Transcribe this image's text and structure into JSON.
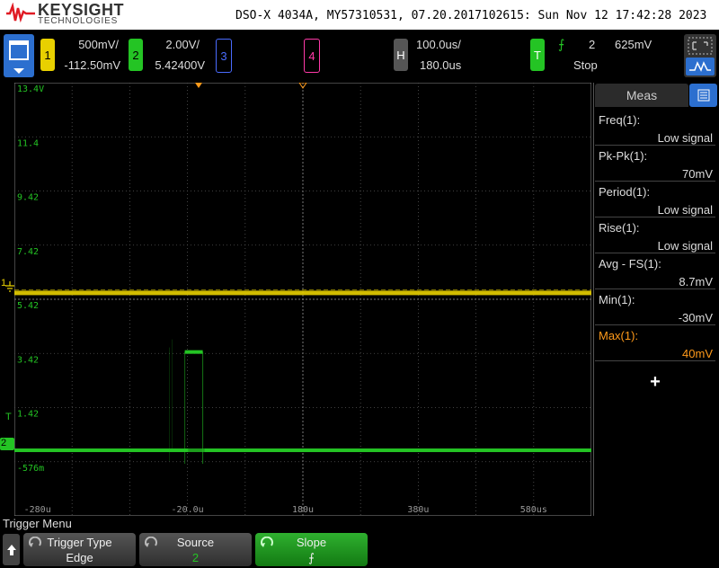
{
  "header": {
    "brand": "KEYSIGHT",
    "brand_sub": "TECHNOLOGIES",
    "scope_id": "DSO-X 4034A, MY57310531, 07.20.2017102615: Sun Nov 12 17:42:28 2023"
  },
  "channels": [
    {
      "num": "1",
      "scale": "500mV/",
      "offset": "-112.50mV",
      "color": "#e8d000"
    },
    {
      "num": "2",
      "scale": "2.00V/",
      "offset": "5.42400V",
      "color": "#24c424"
    },
    {
      "num": "3",
      "color": "#4a6cff"
    },
    {
      "num": "4",
      "color": "#ff3aa8"
    }
  ],
  "horizontal": {
    "label": "H",
    "scale": "100.0us/",
    "position": "180.0us"
  },
  "trigger": {
    "label": "T",
    "source": "2",
    "level": "625mV",
    "state": "Stop",
    "slope_symbol": "⨍"
  },
  "waveform": {
    "y_ticks": [
      "13.4V",
      "11.4",
      "9.42",
      "7.42",
      "5.42",
      "3.42",
      "1.42",
      "-576m"
    ],
    "x_ticks": [
      "-280u",
      "-20.0u",
      "180u",
      "380u",
      "580us"
    ],
    "ch1_level_v": 5.42,
    "ch2_low_v": -0.576,
    "ch2_high_v": 3.42,
    "ch2_pulse_start_us": -20.0,
    "ch2_pulse_end_us": 30.0,
    "marker_ch1": "1",
    "marker_ch2": "2",
    "marker_trig": "T"
  },
  "measurements": {
    "tab": "Meas",
    "items": [
      {
        "name": "Freq(1):",
        "value": "Low signal",
        "highlight": false
      },
      {
        "name": "Pk-Pk(1):",
        "value": "70mV",
        "highlight": false
      },
      {
        "name": "Period(1):",
        "value": "Low signal",
        "highlight": false
      },
      {
        "name": "Rise(1):",
        "value": "Low signal",
        "highlight": false
      },
      {
        "name": "Avg - FS(1):",
        "value": "8.7mV",
        "highlight": false
      },
      {
        "name": "Min(1):",
        "value": "-30mV",
        "highlight": false
      },
      {
        "name": "Max(1):",
        "value": "40mV",
        "highlight": true
      }
    ],
    "add": "+"
  },
  "menu": {
    "title": "Trigger Menu",
    "keys": [
      {
        "label": "Trigger Type",
        "value": "Edge"
      },
      {
        "label": "Source",
        "value": "2"
      },
      {
        "label": "Slope",
        "value": "⨍"
      }
    ]
  },
  "colors": {
    "ch1": "#e8d000",
    "ch2": "#24c424",
    "trigger": "#ff9a1a",
    "accent": "#2c6fcf",
    "highlight": "#ff9a1a"
  }
}
